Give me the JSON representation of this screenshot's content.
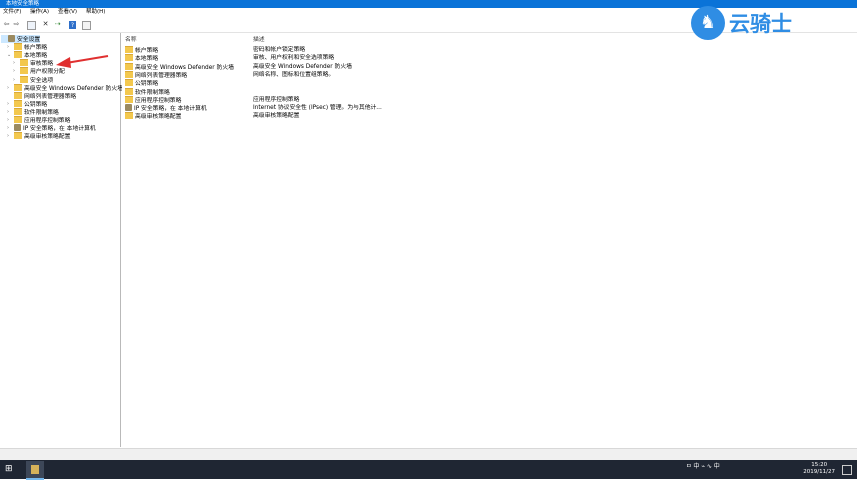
{
  "window": {
    "title": "本地安全策略"
  },
  "menu": [
    "文件(F)",
    "操作(A)",
    "查看(V)",
    "帮助(H)"
  ],
  "tree": [
    {
      "label": "安全设置",
      "depth": 0,
      "exp": "",
      "icon": "shield",
      "selected": true
    },
    {
      "label": "帐户策略",
      "depth": 1,
      "exp": ">",
      "icon": "folder"
    },
    {
      "label": "本地策略",
      "depth": 1,
      "exp": "v",
      "icon": "folder"
    },
    {
      "label": "审核策略",
      "depth": 2,
      "exp": ">",
      "icon": "folder"
    },
    {
      "label": "用户权限分配",
      "depth": 2,
      "exp": ">",
      "icon": "folder"
    },
    {
      "label": "安全选项",
      "depth": 2,
      "exp": ">",
      "icon": "folder"
    },
    {
      "label": "高级安全 Windows Defender 防火墙",
      "depth": 1,
      "exp": ">",
      "icon": "folder"
    },
    {
      "label": "网络列表管理器策略",
      "depth": 1,
      "exp": "",
      "icon": "folder"
    },
    {
      "label": "公钥策略",
      "depth": 1,
      "exp": ">",
      "icon": "folder"
    },
    {
      "label": "软件限制策略",
      "depth": 1,
      "exp": ">",
      "icon": "folder"
    },
    {
      "label": "应用程序控制策略",
      "depth": 1,
      "exp": ">",
      "icon": "folder"
    },
    {
      "label": "IP 安全策略，在 本地计算机",
      "depth": 1,
      "exp": ">",
      "icon": "shield"
    },
    {
      "label": "高级审核策略配置",
      "depth": 1,
      "exp": ">",
      "icon": "folder"
    }
  ],
  "list": {
    "columns": {
      "name": "名称",
      "description": "描述"
    },
    "rows": [
      {
        "name": "帐户策略",
        "description": "密码和帐户锁定策略",
        "icon": "folder"
      },
      {
        "name": "本地策略",
        "description": "审核、用户权利和安全选项策略",
        "icon": "folder"
      },
      {
        "name": "高级安全 Windows Defender 防火墙",
        "description": "高级安全 Windows Defender 防火墙",
        "icon": "folder"
      },
      {
        "name": "网络列表管理器策略",
        "description": "网络名称、图标和位置组策略。",
        "icon": "folder"
      },
      {
        "name": "公钥策略",
        "description": "",
        "icon": "folder"
      },
      {
        "name": "软件限制策略",
        "description": "",
        "icon": "folder"
      },
      {
        "name": "应用程序控制策略",
        "description": "应用程序控制策略",
        "icon": "folder"
      },
      {
        "name": "IP 安全策略，在 本地计算机",
        "description": "Internet 协议安全性 (IPsec) 管理。为与其他计...",
        "icon": "shield"
      },
      {
        "name": "高级审核策略配置",
        "description": "高级审核策略配置",
        "icon": "folder"
      }
    ]
  },
  "taskbar": {
    "tray_text": "ㅁ 中 ⌁ ∿ 中",
    "time": "15:20",
    "date": "2019/11/27"
  },
  "watermark": {
    "text": "云骑士",
    "icon": "knight-logo"
  },
  "colors": {
    "titlebar": "#0a73d8",
    "selection": "#cce8ff",
    "arrow": "#e03030",
    "watermark": "#2f8de4"
  }
}
